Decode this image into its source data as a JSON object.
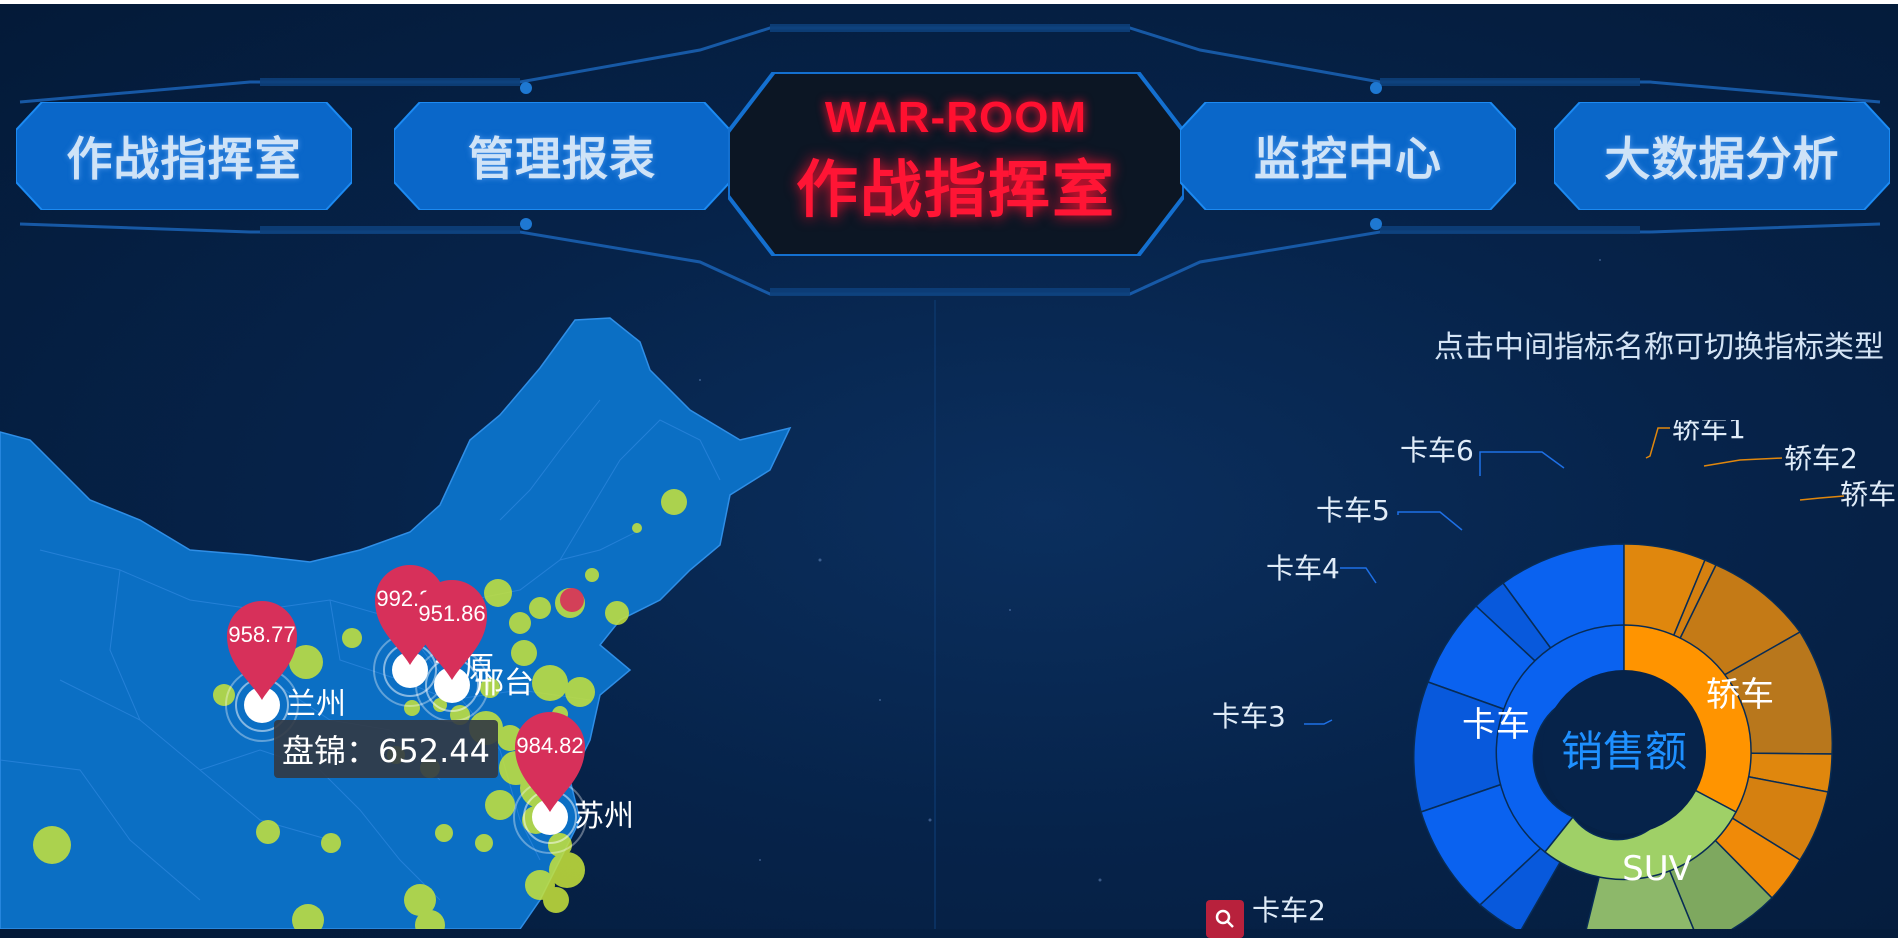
{
  "nav": {
    "tabs": [
      {
        "label": "作战指挥室"
      },
      {
        "label": "管理报表"
      },
      {
        "label": "监控中心"
      },
      {
        "label": "大数据分析"
      }
    ],
    "center": {
      "title_en": "WAR-ROOM",
      "title_cn": "作战指挥室"
    }
  },
  "colors": {
    "accent_red": "#ff1030",
    "bubble": "#c8e43a",
    "pin": "#d7305a",
    "truck": "#0a62f0",
    "car": "#ff9400",
    "suv": "#9fd067"
  },
  "map": {
    "pins": [
      {
        "city": "兰州",
        "value": "958.77"
      },
      {
        "city": "太原",
        "value": "992.30"
      },
      {
        "city": "邢台",
        "value": "951.86"
      },
      {
        "city": "苏州",
        "value": "984.82"
      }
    ],
    "tooltip": "盘锦：652.44"
  },
  "sunburst": {
    "hint": "点击中间指标名称可切换指标类型",
    "center_label": "销售额",
    "inner": [
      {
        "label": "卡车"
      },
      {
        "label": "轿车"
      },
      {
        "label": "SUV"
      }
    ],
    "outer_labels": {
      "truck6": "卡车6",
      "truck5": "卡车5",
      "truck4": "卡车4",
      "truck3": "卡车3",
      "truck2": "卡车2",
      "car1": "轿车1",
      "car2": "轿车2",
      "car3": "轿车"
    }
  },
  "icons": {
    "zoom": "search-icon"
  }
}
